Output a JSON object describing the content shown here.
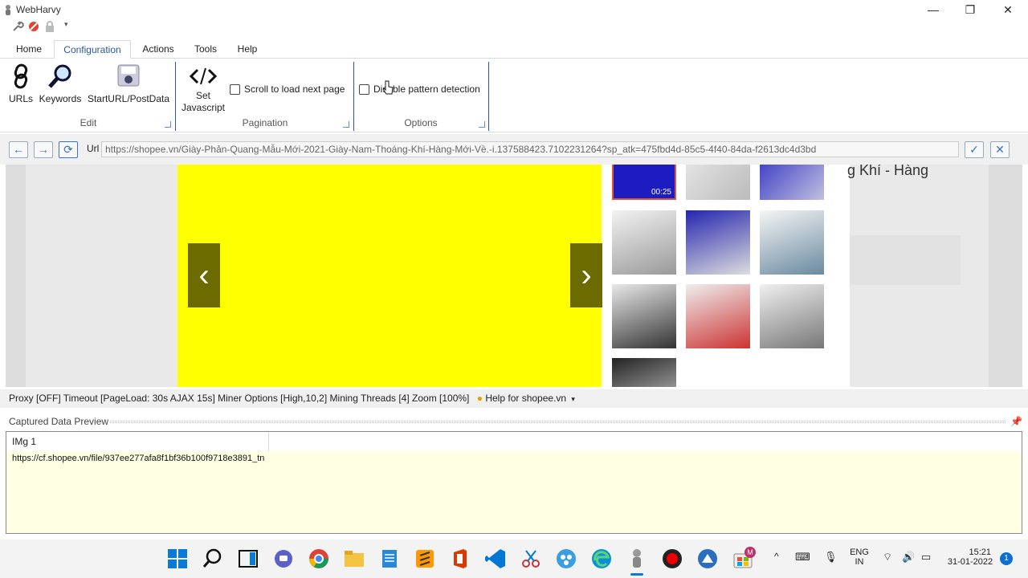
{
  "window": {
    "title": "WebHarvy",
    "minimize_icon": "minimize-icon",
    "restore_icon": "restore-icon",
    "close_icon": "close-icon"
  },
  "ribbon": {
    "tabs": [
      "Home",
      "Configuration",
      "Actions",
      "Tools",
      "Help"
    ],
    "active_tab": "Configuration",
    "edit_group": {
      "label": "Edit",
      "buttons": [
        {
          "label": "URLs",
          "icon": "link-icon"
        },
        {
          "label": "Keywords",
          "icon": "search-icon"
        },
        {
          "label": "StartURL/PostData",
          "icon": "disk-icon"
        }
      ]
    },
    "pagination_group": {
      "label": "Pagination",
      "set_js_label_1": "Set",
      "set_js_label_2": "Javascript",
      "scroll_label": "Scroll to load next page",
      "scroll_checked": false
    },
    "options_group": {
      "label": "Options",
      "disable_pattern_label": "Disable pattern detection",
      "disable_pattern_checked": false
    }
  },
  "urlbar": {
    "label": "Url",
    "url": "https://shopee.vn/Giày-Phản-Quang-Mẫu-Mới-2021-Giày-Nam-Thoáng-Khí-Hàng-Mới-Về.-i.137588423.7102231264?sp_atk=475fbd4d-85c5-4f40-84da-f2613dc4d3bd"
  },
  "browser": {
    "video_time": "00:25",
    "product_title_fragment": "g Khí - Hàng"
  },
  "status": {
    "text": "Proxy [OFF] Timeout [PageLoad: 30s AJAX 15s] Miner Options [High,10,2] Mining Threads [4] Zoom [100%]",
    "help_label": "Help for shopee.vn"
  },
  "captured": {
    "title": "Captured Data Preview",
    "column": "IMg 1",
    "value": "https://cf.shopee.vn/file/937ee277afa8f1bf36b100f9718e3891_tn"
  },
  "taskbar": {
    "lang_line1": "ENG",
    "lang_line2": "IN",
    "time": "15:21",
    "date": "31-01-2022",
    "notification_count": "1",
    "badge_letter": "M"
  },
  "colors": {
    "accent": "#2b579a",
    "banner_yellow": "#ffff00",
    "arrow_bg": "#6b6b00",
    "preview_bg": "#ffffe4"
  }
}
